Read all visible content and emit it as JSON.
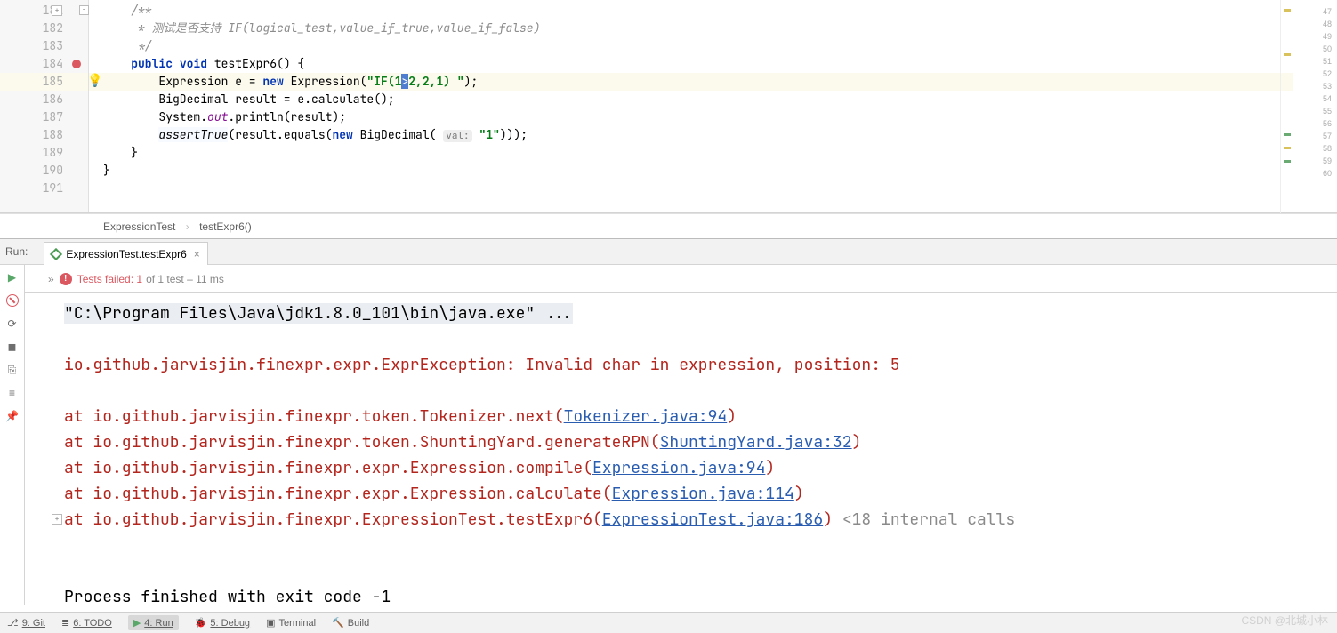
{
  "editor": {
    "gutter_lines": [
      "181",
      "182",
      "183",
      "184",
      "185",
      "186",
      "187",
      "188",
      "189",
      "190",
      "191"
    ],
    "right_lines": [
      "47",
      "48",
      "49",
      "50",
      "51",
      "52",
      "53",
      "54",
      "55",
      "56",
      "57",
      "58",
      "59",
      "60"
    ],
    "code": {
      "l181": "    /**",
      "l182": "     * 测试是否支持 IF(logical_test,value_if_true,value_if_false)",
      "l183": "     */",
      "l184_kw1": "public",
      "l184_kw2": "void",
      "l184_rest": " testExpr6() {",
      "l185_pre": "        Expression e = ",
      "l185_new": "new",
      "l185_mid": " Expression(",
      "l185_str1": "\"IF(1",
      "l185_sel": ">",
      "l185_str2": "2,2,1) \"",
      "l185_end": ");",
      "l186": "        BigDecimal result = e.calculate();",
      "l187_pre": "        System.",
      "l187_out": "out",
      "l187_post": ".println(result);",
      "l188_assert": "assertTrue",
      "l188_mid1": "(result.equals(",
      "l188_new": "new",
      "l188_mid2": " BigDecimal( ",
      "l188_hint": "val:",
      "l188_str": " \"1\"",
      "l188_end": ")));",
      "l189": "    }",
      "l190": "}",
      "l191": ""
    }
  },
  "breadcrumb": {
    "a": "ExpressionTest",
    "b": "testExpr6()"
  },
  "run_tab": {
    "prefix": "Run:",
    "title": "ExpressionTest.testExpr6",
    "close": "×"
  },
  "test_status": {
    "fail_label": "Tests failed: 1",
    "suffix": " of 1 test – 11 ms"
  },
  "console": {
    "cmd": "\"C:\\Program Files\\Java\\jdk1.8.0_101\\bin\\java.exe\" ...",
    "exc": "io.github.jarvisjin.finexpr.expr.ExprException: Invalid char in expression, position: 5",
    "at1_pre": "    at io.github.jarvisjin.finexpr.token.Tokenizer.next(",
    "at1_link": "Tokenizer.java:94",
    "at1_post": ")",
    "at2_pre": "    at io.github.jarvisjin.finexpr.token.ShuntingYard.generateRPN(",
    "at2_link": "ShuntingYard.java:32",
    "at2_post": ")",
    "at3_pre": "    at io.github.jarvisjin.finexpr.expr.Expression.compile(",
    "at3_link": "Expression.java:94",
    "at3_post": ")",
    "at4_pre": "    at io.github.jarvisjin.finexpr.expr.Expression.calculate(",
    "at4_link": "Expression.java:114",
    "at4_post": ")",
    "at5_pre": "    at io.github.jarvisjin.finexpr.ExpressionTest.testExpr6(",
    "at5_link": "ExpressionTest.java:186",
    "at5_post": ")",
    "at5_dim": " <18 internal calls",
    "exit": "Process finished with exit code -1"
  },
  "bottom": {
    "git": "9: Git",
    "todo": "6: TODO",
    "run": "4: Run",
    "debug": "5: Debug",
    "terminal": "Terminal",
    "build": "Build"
  },
  "watermark": "CSDN @北城小林"
}
